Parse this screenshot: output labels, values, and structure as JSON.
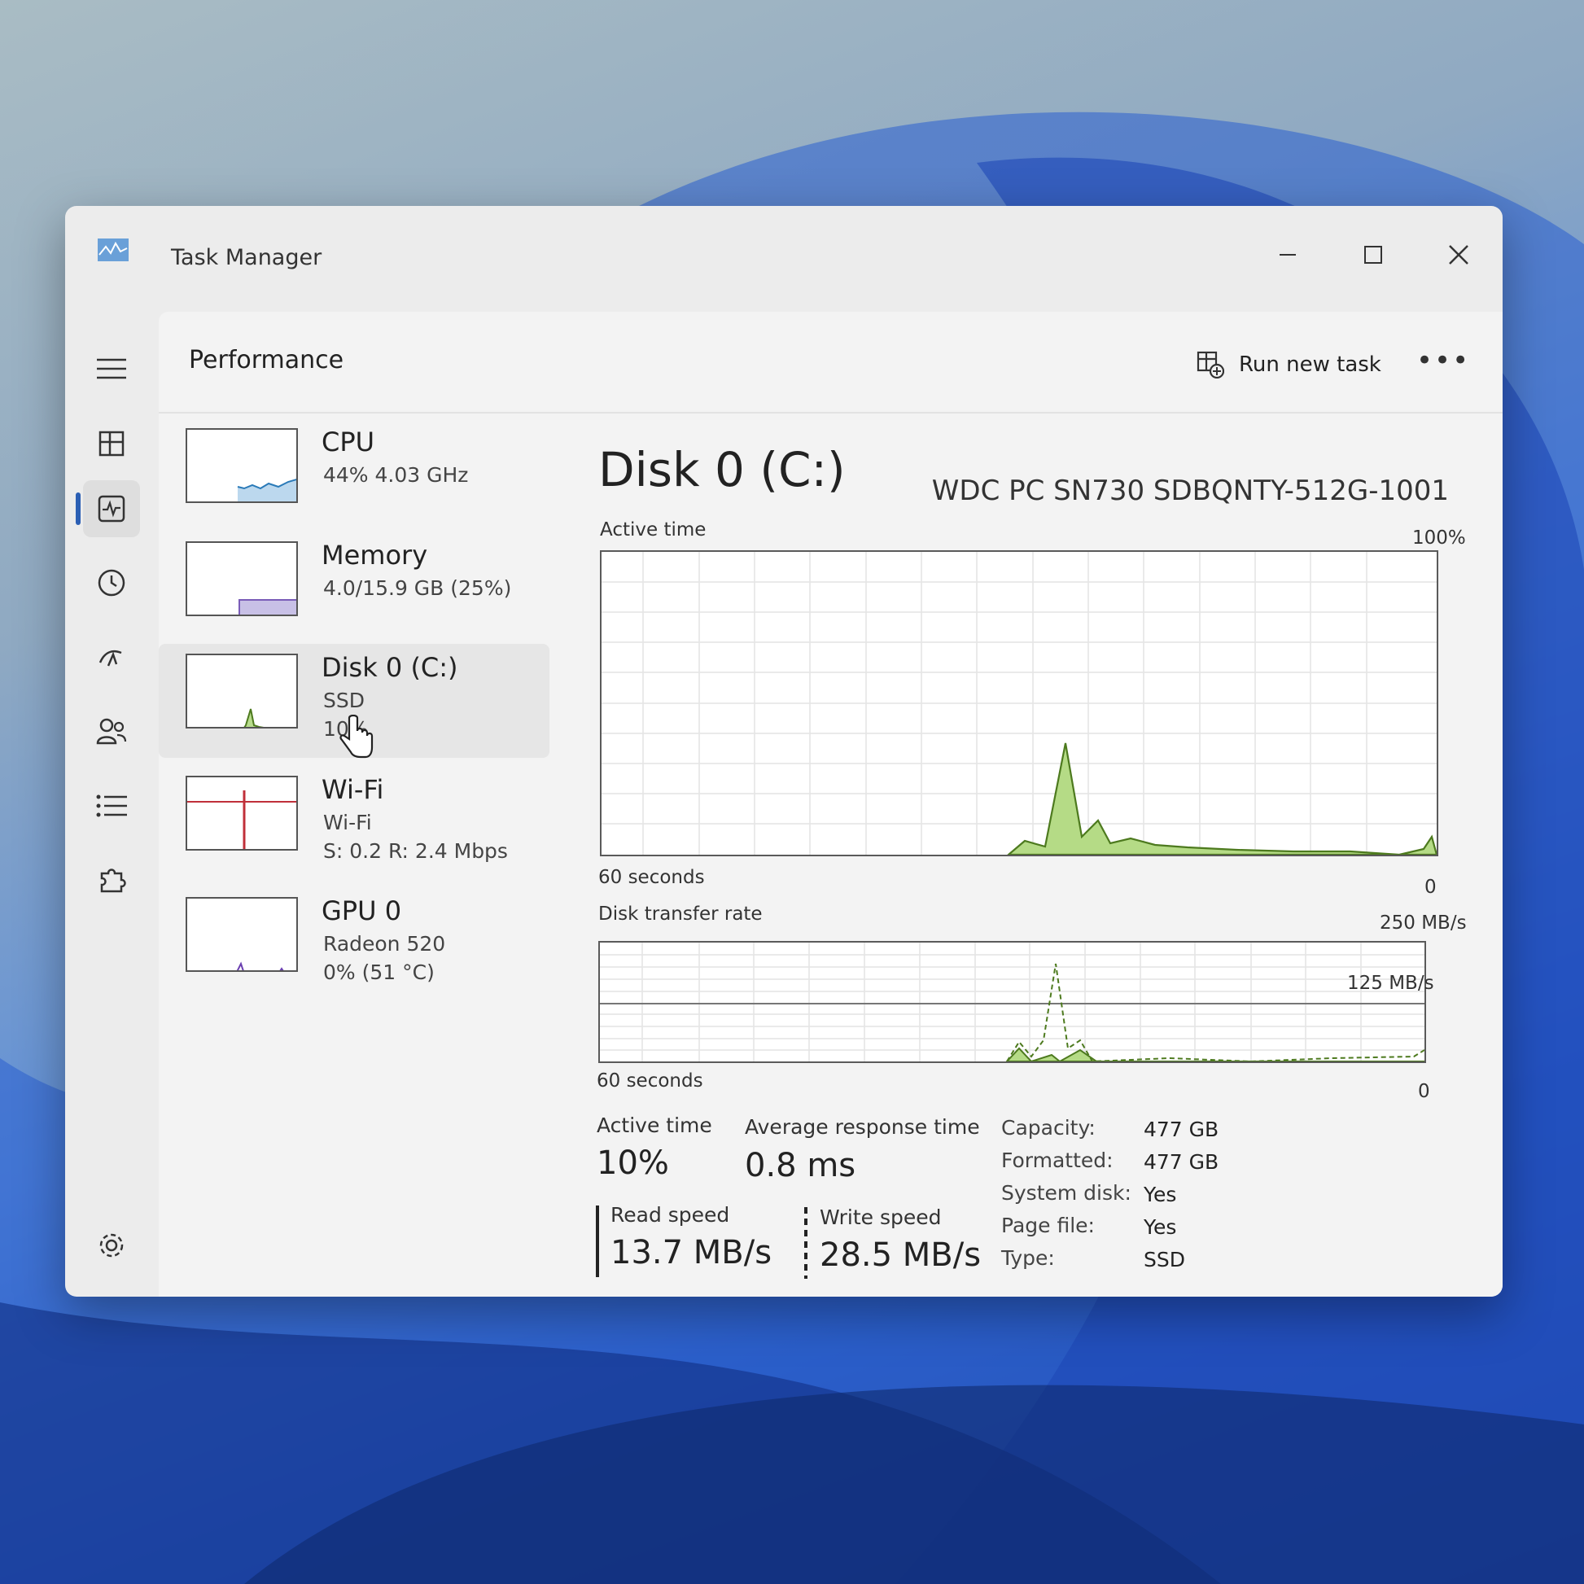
{
  "window": {
    "title": "Task Manager"
  },
  "page": {
    "title": "Performance",
    "run_new_task": "Run new task",
    "more": "•••"
  },
  "side_items": [
    {
      "name": "CPU",
      "line1": "44%  4.03 GHz",
      "line2": ""
    },
    {
      "name": "Memory",
      "line1": "4.0/15.9 GB (25%)",
      "line2": ""
    },
    {
      "name": "Disk 0 (C:)",
      "line1": "SSD",
      "line2": "10%"
    },
    {
      "name": "Wi-Fi",
      "line1": "Wi-Fi",
      "line2": "S: 0.2  R: 2.4 Mbps"
    },
    {
      "name": "GPU 0",
      "line1": "Radeon 520",
      "line2": "0%  (51 °C)"
    }
  ],
  "detail": {
    "title": "Disk 0 (C:)",
    "model": "WDC PC SN730 SDBQNTY-512G-1001",
    "active_chart": {
      "label": "Active time",
      "max": "100%",
      "span": "60 seconds",
      "min": "0"
    },
    "transfer_chart": {
      "label": "Disk transfer rate",
      "max": "250 MB/s",
      "mid": "125 MB/s",
      "span": "60 seconds",
      "min": "0"
    },
    "stats": {
      "active_time_label": "Active time",
      "active_time": "10%",
      "avg_response_label": "Average response time",
      "avg_response": "0.8 ms",
      "read_label": "Read speed",
      "read": "13.7 MB/s",
      "write_label": "Write speed",
      "write": "28.5 MB/s"
    },
    "props": [
      {
        "key": "Capacity:",
        "value": "477 GB"
      },
      {
        "key": "Formatted:",
        "value": "477 GB"
      },
      {
        "key": "System disk:",
        "value": "Yes"
      },
      {
        "key": "Page file:",
        "value": "Yes"
      },
      {
        "key": "Type:",
        "value": "SSD"
      }
    ]
  },
  "colors": {
    "disk": "#8bc34a",
    "disk_line": "#4d7a1e",
    "cpu": "#2a7ab8",
    "memory": "#7a5cb8",
    "wifi": "#c0303a",
    "gpu": "#6a3fb0",
    "accent": "#2b5fb4"
  }
}
